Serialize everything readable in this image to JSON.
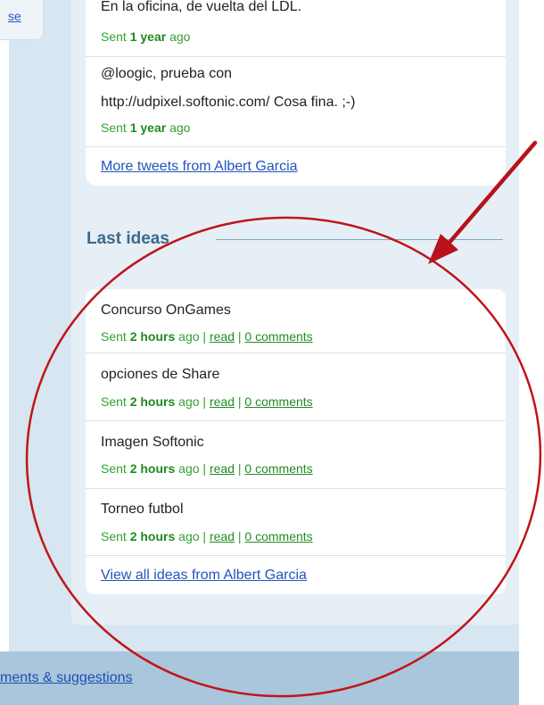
{
  "left_tab": {
    "link_text": "se"
  },
  "tweets": {
    "items": [
      {
        "text": "En la oficina, de vuelta del LDL.",
        "sent_prefix": "Sent",
        "age": "1 year",
        "sent_suffix": "ago"
      },
      {
        "text_line1": "@loogic, prueba con",
        "text_line2": "http://udpixel.softonic.com/ Cosa fina. ;-)",
        "sent_prefix": "Sent",
        "age": "1 year",
        "sent_suffix": "ago"
      }
    ],
    "more_link": "More tweets from Albert Garcia"
  },
  "ideas": {
    "title": "Last ideas",
    "items": [
      {
        "title": "Concurso OnGames",
        "sent_prefix": "Sent",
        "age": "2 hours",
        "sent_suffix": "ago",
        "sep": "|",
        "read": "read",
        "comments": "0 comments"
      },
      {
        "title": "opciones de Share",
        "sent_prefix": "Sent",
        "age": "2 hours",
        "sent_suffix": "ago",
        "sep": "|",
        "read": "read",
        "comments": "0 comments"
      },
      {
        "title": "Imagen Softonic",
        "sent_prefix": "Sent",
        "age": "2 hours",
        "sent_suffix": "ago",
        "sep": "|",
        "read": "read",
        "comments": "0 comments"
      },
      {
        "title": "Torneo futbol",
        "sent_prefix": "Sent",
        "age": "2 hours",
        "sent_suffix": "ago",
        "sep": "|",
        "read": "read",
        "comments": "0 comments"
      }
    ],
    "view_all_link": "View all ideas from Albert Garcia"
  },
  "footer": {
    "link_text": "ments & suggestions"
  },
  "colors": {
    "link": "#2255bb",
    "sent_green": "#33a030",
    "section_title": "#3d6a88",
    "annotation_red": "#c0151a"
  }
}
